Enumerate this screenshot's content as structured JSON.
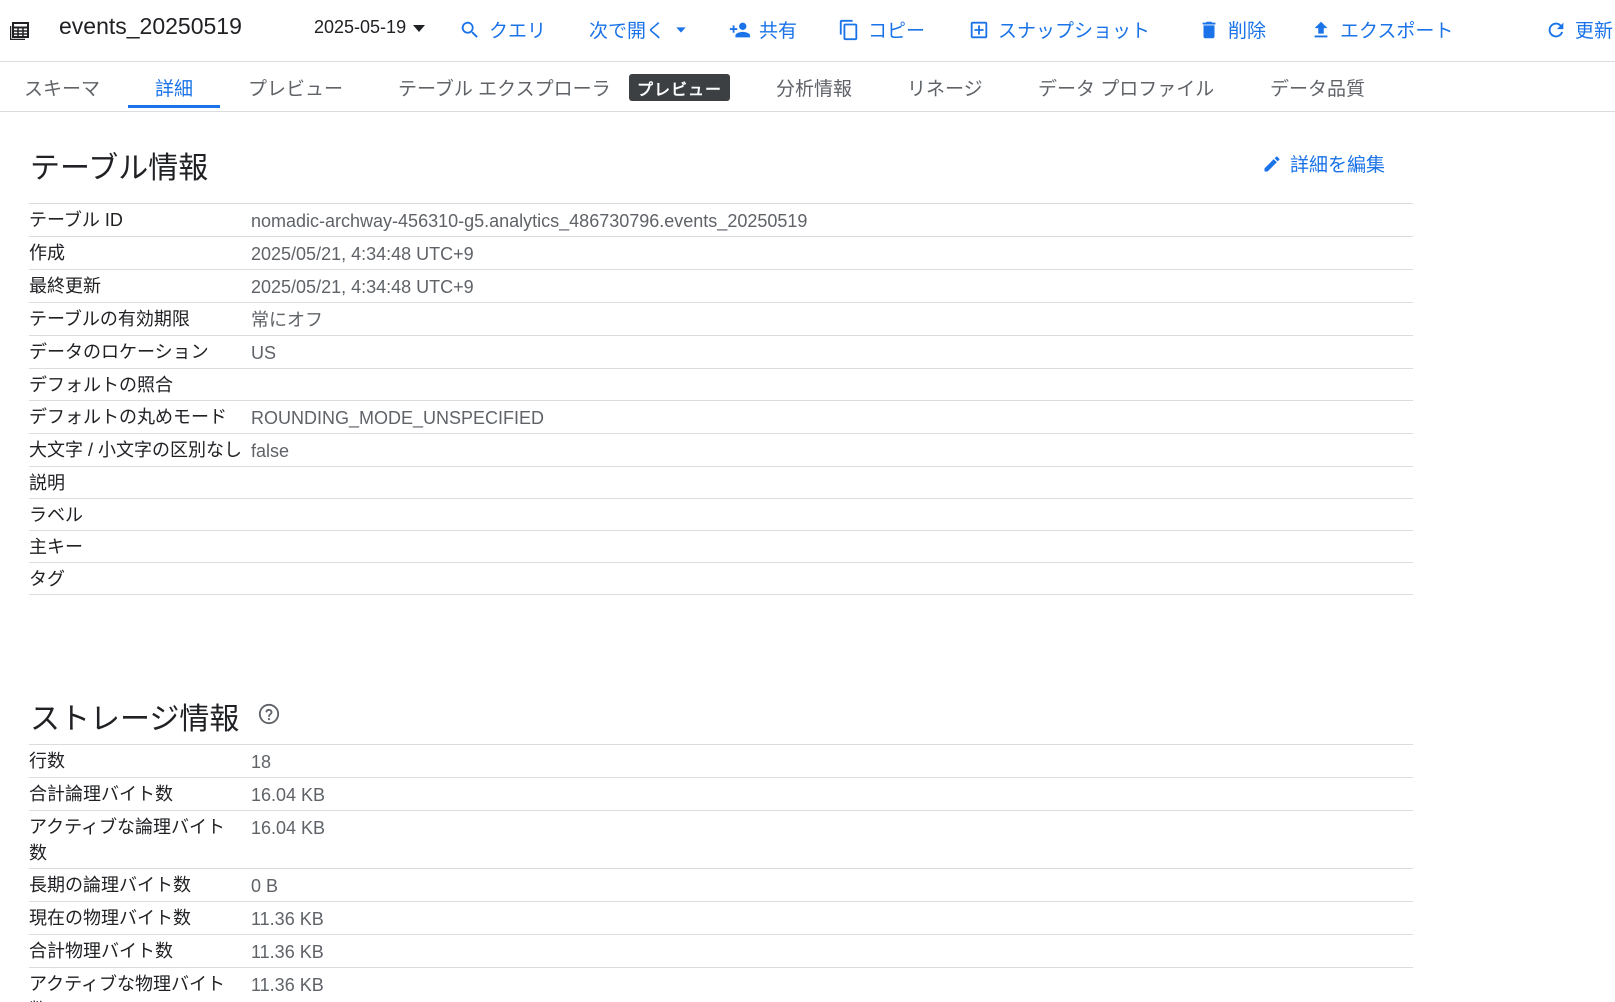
{
  "toolbar": {
    "table_name": "events_20250519",
    "date": "2025-05-19",
    "query_label": "クエリ",
    "open_with_label": "次で開く",
    "share_label": "共有",
    "copy_label": "コピー",
    "snapshot_label": "スナップショット",
    "delete_label": "削除",
    "export_label": "エクスポート",
    "refresh_label": "更新"
  },
  "tabs": {
    "schema": "スキーマ",
    "details": "詳細",
    "preview": "プレビュー",
    "explorer": "テーブル エクスプローラ",
    "explorer_badge": "プレビュー",
    "insights": "分析情報",
    "lineage": "リネージ",
    "profile": "データ プロファイル",
    "quality": "データ品質"
  },
  "table_info": {
    "title": "テーブル情報",
    "edit_label": "詳細を編集",
    "rows": [
      {
        "key": "テーブル ID",
        "value": "nomadic-archway-456310-g5.analytics_486730796.events_20250519"
      },
      {
        "key": "作成",
        "value": "2025/05/21, 4:34:48 UTC+9"
      },
      {
        "key": "最終更新",
        "value": "2025/05/21, 4:34:48 UTC+9"
      },
      {
        "key": "テーブルの有効期限",
        "value": "常にオフ"
      },
      {
        "key": "データのロケーション",
        "value": "US"
      },
      {
        "key": "デフォルトの照合",
        "value": ""
      },
      {
        "key": "デフォルトの丸めモード",
        "value": "ROUNDING_MODE_UNSPECIFIED"
      },
      {
        "key": "大文字 / 小文字の区別なし",
        "value": "false"
      },
      {
        "key": "説明",
        "value": ""
      },
      {
        "key": "ラベル",
        "value": ""
      },
      {
        "key": "主キー",
        "value": ""
      },
      {
        "key": "タグ",
        "value": ""
      }
    ]
  },
  "storage_info": {
    "title": "ストレージ情報",
    "rows": [
      {
        "key": "行数",
        "value": "18"
      },
      {
        "key": "合計論理バイト数",
        "value": "16.04 KB"
      },
      {
        "key": "アクティブな論理バイト数",
        "value": "16.04 KB"
      },
      {
        "key": "長期の論理バイト数",
        "value": "0 B"
      },
      {
        "key": "現在の物理バイト数",
        "value": "11.36 KB"
      },
      {
        "key": "合計物理バイト数",
        "value": "11.36 KB"
      },
      {
        "key": "アクティブな物理バイト数",
        "value": "11.36 KB"
      }
    ]
  }
}
